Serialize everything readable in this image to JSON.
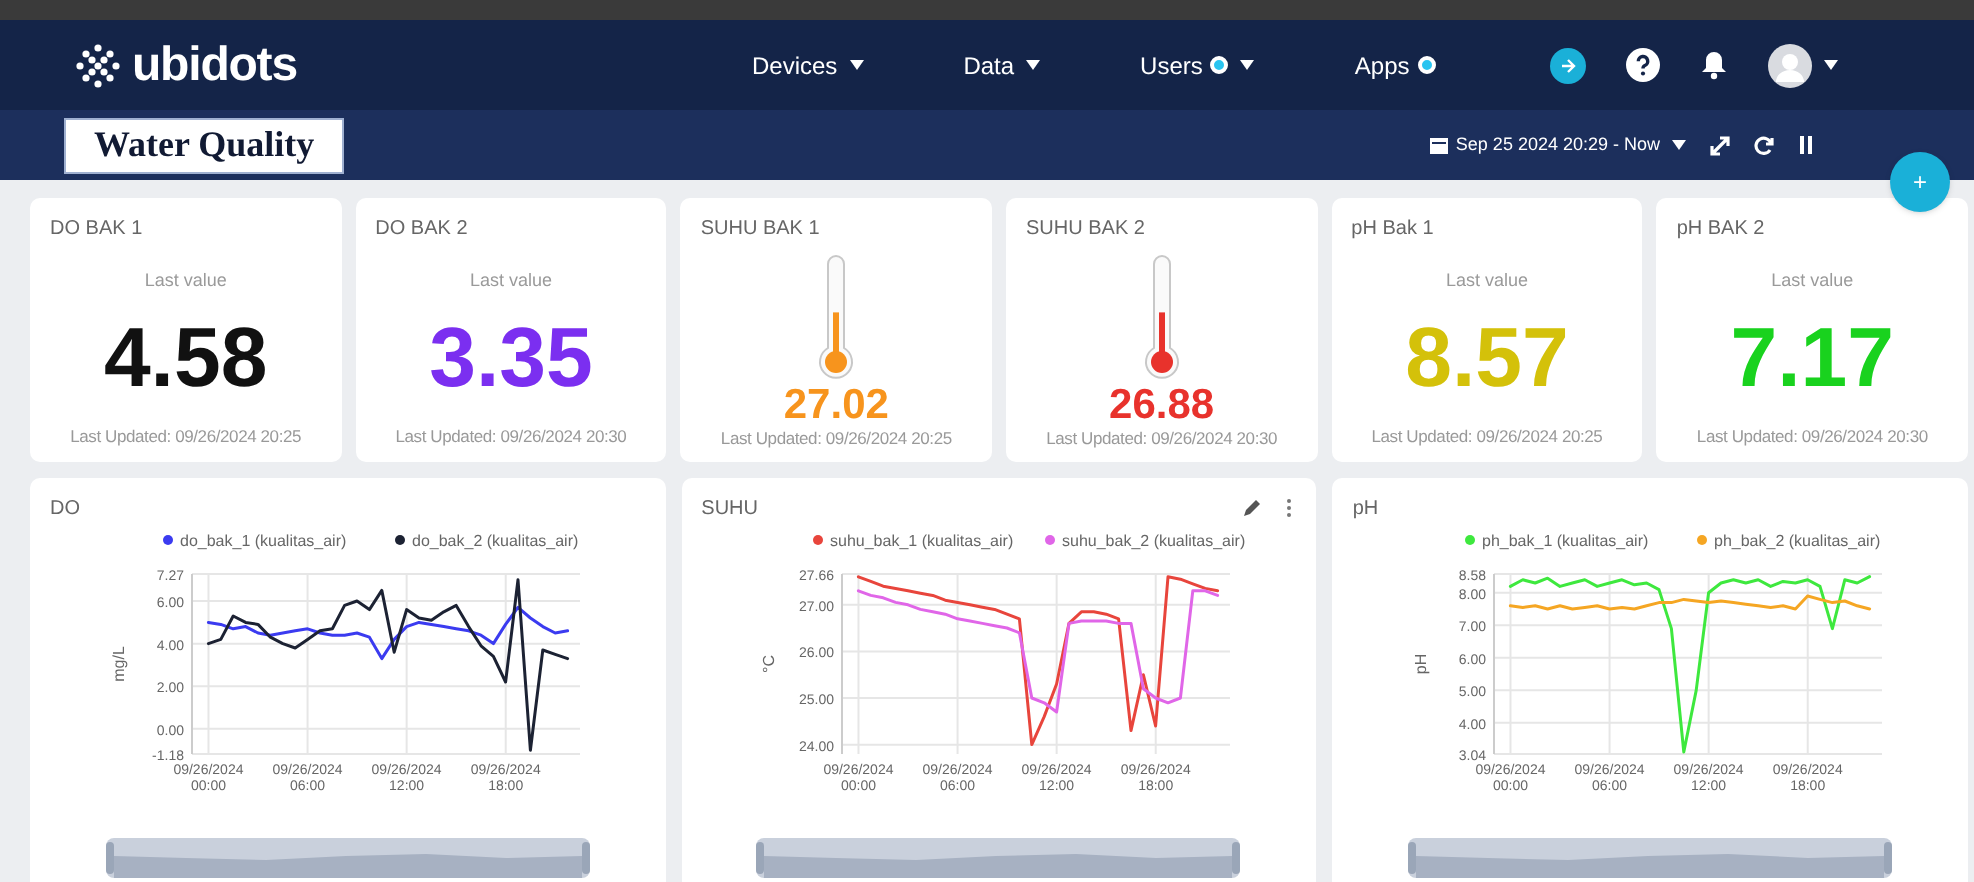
{
  "navbar": {
    "logo": "ubidots",
    "menu": [
      {
        "label": "Devices",
        "dropdown": true,
        "dot": false
      },
      {
        "label": "Data",
        "dropdown": true,
        "dot": false
      },
      {
        "label": "Users",
        "dropdown": true,
        "dot": true
      },
      {
        "label": "Apps",
        "dropdown": false,
        "dot": true
      }
    ]
  },
  "dashboard": {
    "title": "Water Quality",
    "date_range": "Sep 25 2024 20:29 - Now"
  },
  "add_button": "+",
  "cards": [
    {
      "kind": "metric",
      "title": "DO BAK 1",
      "caption": "Last value",
      "value": "4.58",
      "color": "#111111",
      "updated": "Last Updated: 09/26/2024 20:25"
    },
    {
      "kind": "metric",
      "title": "DO BAK 2",
      "caption": "Last value",
      "value": "3.35",
      "color": "#7b2ff0",
      "updated": "Last Updated: 09/26/2024 20:30"
    },
    {
      "kind": "thermometer",
      "title": "SUHU BAK 1",
      "level": 0.45,
      "value": "27.02",
      "color": "#f7941d",
      "updated": "Last Updated: 09/26/2024 20:25"
    },
    {
      "kind": "thermometer",
      "title": "SUHU BAK 2",
      "level": 0.45,
      "value": "26.88",
      "color": "#e8322c",
      "updated": "Last Updated: 09/26/2024 20:30"
    },
    {
      "kind": "metric",
      "title": "pH Bak 1",
      "caption": "Last value",
      "value": "8.57",
      "color": "#d4c10a",
      "updated": "Last Updated: 09/26/2024 20:25"
    },
    {
      "kind": "metric",
      "title": "pH BAK 2",
      "caption": "Last value",
      "value": "7.17",
      "color": "#19d21e",
      "updated": "Last Updated: 09/26/2024 20:30"
    }
  ],
  "charts": [
    {
      "title": "DO",
      "toolbar": false,
      "chart_data": {
        "type": "line",
        "ylabel": "mg/L",
        "grid": true,
        "legend": "top",
        "categories": [
          "09/26/2024 00:00",
          null,
          null,
          null,
          null,
          null,
          null,
          null,
          "09/26/2024 06:00",
          null,
          null,
          null,
          null,
          null,
          null,
          null,
          "09/26/2024 12:00",
          null,
          null,
          null,
          null,
          null,
          null,
          null,
          "09/26/2024 18:00",
          null,
          null,
          null,
          null,
          null
        ],
        "ylim": [
          -1.18,
          7.27
        ],
        "yticks": [
          {
            "value": 7.27,
            "label": "7.27"
          },
          {
            "value": 6,
            "label": "6.00"
          },
          {
            "value": 4,
            "label": "4.00"
          },
          {
            "value": 2,
            "label": "2.00"
          },
          {
            "value": 0,
            "label": "0.00"
          },
          {
            "value": -1.18,
            "label": "-1.18"
          }
        ],
        "series": [
          {
            "name": "do_bak_1 (kualitas_air)",
            "color": "#3b3bf0",
            "values": [
              5.0,
              4.9,
              4.7,
              4.8,
              4.5,
              4.4,
              4.5,
              4.6,
              4.7,
              4.5,
              4.4,
              4.4,
              4.5,
              4.3,
              3.3,
              4.2,
              4.8,
              5.0,
              4.9,
              4.8,
              4.7,
              4.6,
              4.4,
              4.0,
              4.9,
              5.7,
              5.2,
              4.8,
              4.5,
              4.6
            ]
          },
          {
            "name": "do_bak_2 (kualitas_air)",
            "color": "#1c2233",
            "values": [
              4.0,
              4.2,
              5.3,
              5.0,
              4.9,
              4.3,
              4.0,
              3.8,
              4.2,
              4.6,
              4.7,
              5.8,
              6.0,
              5.6,
              6.5,
              3.6,
              5.6,
              5.2,
              5.1,
              5.5,
              5.8,
              4.8,
              3.9,
              3.4,
              2.2,
              7.0,
              -1.0,
              3.7,
              3.5,
              3.3
            ]
          }
        ]
      }
    },
    {
      "title": "SUHU",
      "toolbar": true,
      "chart_data": {
        "type": "line",
        "ylabel": "°C",
        "grid": true,
        "legend": "top",
        "categories": [
          "09/26/2024 00:00",
          null,
          null,
          null,
          null,
          null,
          null,
          null,
          "09/26/2024 06:00",
          null,
          null,
          null,
          null,
          null,
          null,
          null,
          "09/26/2024 12:00",
          null,
          null,
          null,
          null,
          null,
          null,
          null,
          "09/26/2024 18:00",
          null,
          null,
          null,
          null,
          null
        ],
        "ylim": [
          23.8,
          27.66
        ],
        "yticks": [
          {
            "value": 27.66,
            "label": "27.66"
          },
          {
            "value": 27,
            "label": "27.00"
          },
          {
            "value": 26,
            "label": "26.00"
          },
          {
            "value": 25,
            "label": "25.00"
          },
          {
            "value": 24,
            "label": "24.00"
          }
        ],
        "series": [
          {
            "name": "suhu_bak_1 (kualitas_air)",
            "color": "#e8453c",
            "values": [
              27.6,
              27.5,
              27.4,
              27.35,
              27.3,
              27.25,
              27.2,
              27.1,
              27.05,
              27.0,
              26.95,
              26.9,
              26.8,
              26.7,
              24.0,
              24.6,
              25.3,
              26.6,
              26.85,
              26.85,
              26.8,
              26.7,
              24.3,
              25.5,
              24.4,
              27.6,
              27.55,
              27.45,
              27.35,
              27.3
            ]
          },
          {
            "name": "suhu_bak_2 (kualitas_air)",
            "color": "#e066e8",
            "values": [
              27.3,
              27.2,
              27.15,
              27.05,
              27.0,
              26.9,
              26.85,
              26.8,
              26.7,
              26.65,
              26.6,
              26.55,
              26.5,
              26.4,
              25.0,
              24.9,
              24.7,
              26.6,
              26.65,
              26.65,
              26.65,
              26.6,
              26.6,
              25.2,
              25.0,
              24.9,
              25.0,
              27.3,
              27.3,
              27.2
            ]
          }
        ]
      }
    },
    {
      "title": "pH",
      "toolbar": false,
      "chart_data": {
        "type": "line",
        "ylabel": "pH",
        "grid": true,
        "legend": "top",
        "categories": [
          "09/26/2024 00:00",
          null,
          null,
          null,
          null,
          null,
          null,
          null,
          "09/26/2024 06:00",
          null,
          null,
          null,
          null,
          null,
          null,
          null,
          "09/26/2024 12:00",
          null,
          null,
          null,
          null,
          null,
          null,
          null,
          "09/26/2024 18:00",
          null,
          null,
          null,
          null,
          null
        ],
        "ylim": [
          3.04,
          8.58
        ],
        "yticks": [
          {
            "value": 8.58,
            "label": "8.58"
          },
          {
            "value": 8,
            "label": "8.00"
          },
          {
            "value": 7,
            "label": "7.00"
          },
          {
            "value": 6,
            "label": "6.00"
          },
          {
            "value": 5,
            "label": "5.00"
          },
          {
            "value": 4,
            "label": "4.00"
          },
          {
            "value": 3.04,
            "label": "3.04"
          }
        ],
        "series": [
          {
            "name": "ph_bak_1 (kualitas_air)",
            "color": "#3ee83e",
            "values": [
              8.2,
              8.4,
              8.3,
              8.45,
              8.2,
              8.3,
              8.4,
              8.2,
              8.3,
              8.4,
              8.25,
              8.3,
              8.1,
              6.9,
              3.1,
              5.0,
              8.0,
              8.3,
              8.4,
              8.3,
              8.4,
              8.2,
              8.35,
              8.3,
              8.4,
              8.2,
              6.9,
              8.4,
              8.3,
              8.5
            ]
          },
          {
            "name": "ph_bak_2 (kualitas_air)",
            "color": "#f5a623",
            "values": [
              7.6,
              7.55,
              7.6,
              7.5,
              7.6,
              7.5,
              7.55,
              7.6,
              7.5,
              7.55,
              7.5,
              7.6,
              7.7,
              7.7,
              7.8,
              7.75,
              7.7,
              7.75,
              7.7,
              7.65,
              7.6,
              7.55,
              7.6,
              7.5,
              7.9,
              7.8,
              7.7,
              7.75,
              7.6,
              7.5
            ]
          }
        ]
      }
    }
  ]
}
